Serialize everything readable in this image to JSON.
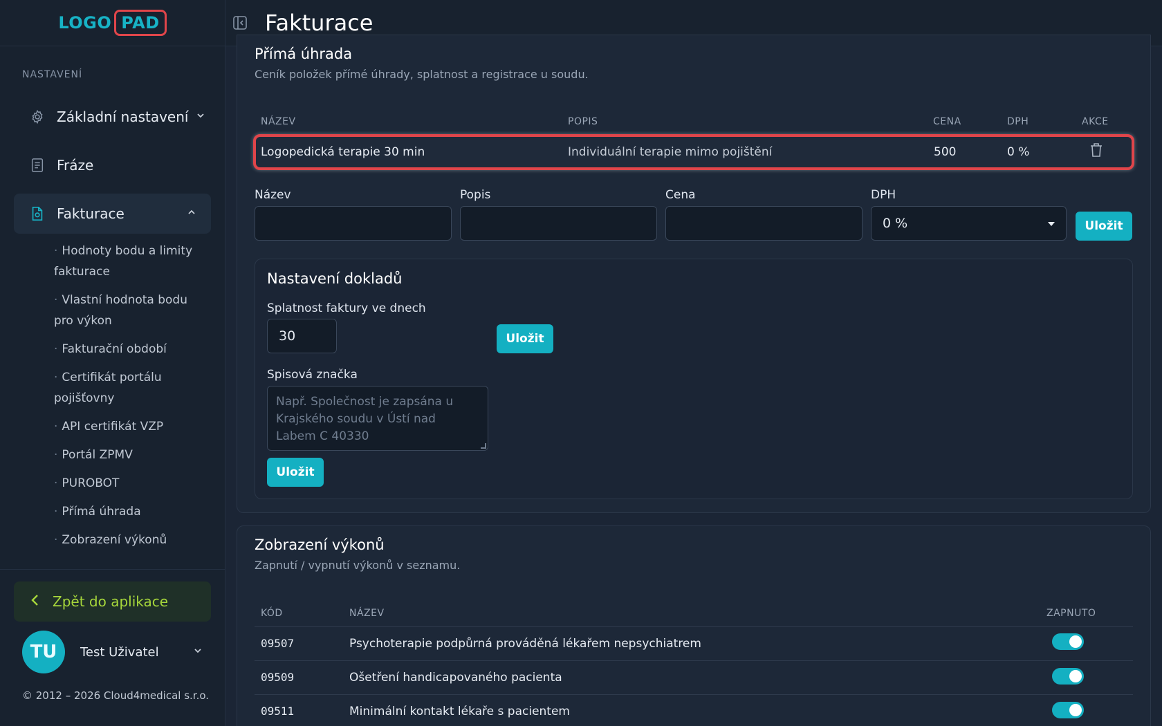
{
  "logo": {
    "part1": "LOGO",
    "part2": "PAD"
  },
  "header": {
    "title": "Fakturace"
  },
  "sidebar": {
    "section_label": "NASTAVENÍ",
    "items": [
      {
        "label": "Základní nastavení",
        "icon": "gear-icon"
      },
      {
        "label": "Fráze",
        "icon": "document-icon"
      },
      {
        "label": "Fakturace",
        "icon": "invoice-icon"
      }
    ],
    "subitems": [
      "Hodnoty bodu a limity fakturace",
      "Vlastní hodnota bodu pro výkon",
      "Fakturační období",
      "Certifikát portálu pojišťovny",
      "API certifikát VZP",
      "Portál ZPMV",
      "PUROBOT",
      "Přímá úhrada",
      "Zobrazení výkonů"
    ],
    "back_label": "Zpět do aplikace",
    "user": {
      "initials": "TU",
      "name": "Test Uživatel"
    },
    "copyright": "© 2012 – 2026 Cloud4medical s.r.o."
  },
  "direct_payment": {
    "title": "Přímá úhrada",
    "subtitle": "Ceník položek přímé úhrady, splatnost a registrace u soudu.",
    "columns": {
      "name": "NÁZEV",
      "description": "POPIS",
      "price": "CENA",
      "vat": "DPH",
      "actions": "AKCE"
    },
    "row": {
      "name": "Logopedická terapie 30 min",
      "description": "Individuální terapie mimo pojištění",
      "price": "500",
      "vat": "0 %"
    },
    "form": {
      "name_label": "Název",
      "description_label": "Popis",
      "price_label": "Cena",
      "vat_label": "DPH",
      "vat_value": "0 %",
      "save_label": "Uložit"
    }
  },
  "documents": {
    "title": "Nastavení dokladů",
    "due_label": "Splatnost faktury ve dnech",
    "due_value": "30",
    "save_label": "Uložit",
    "file_label": "Spisová značka",
    "file_placeholder": "Např. Společnost je zapsána u Krajského soudu v Ústí nad Labem C 40330",
    "save2_label": "Uložit"
  },
  "procedures": {
    "title": "Zobrazení výkonů",
    "subtitle": "Zapnutí / vypnutí výkonů v seznamu.",
    "columns": {
      "code": "KÓD",
      "name": "NÁZEV",
      "enabled": "ZAPNUTO"
    },
    "rows": [
      {
        "code": "09507",
        "name": "Psychoterapie podpůrná prováděná lékařem nepsychiatrem",
        "enabled": true
      },
      {
        "code": "09509",
        "name": "Ošetření handicapovaného pacienta",
        "enabled": true
      },
      {
        "code": "09511",
        "name": "Minimální kontakt lékaře s pacientem",
        "enabled": true
      }
    ]
  },
  "colors": {
    "accent": "#14b0c2",
    "highlight": "#e0454a",
    "back": "#a6d63b"
  }
}
